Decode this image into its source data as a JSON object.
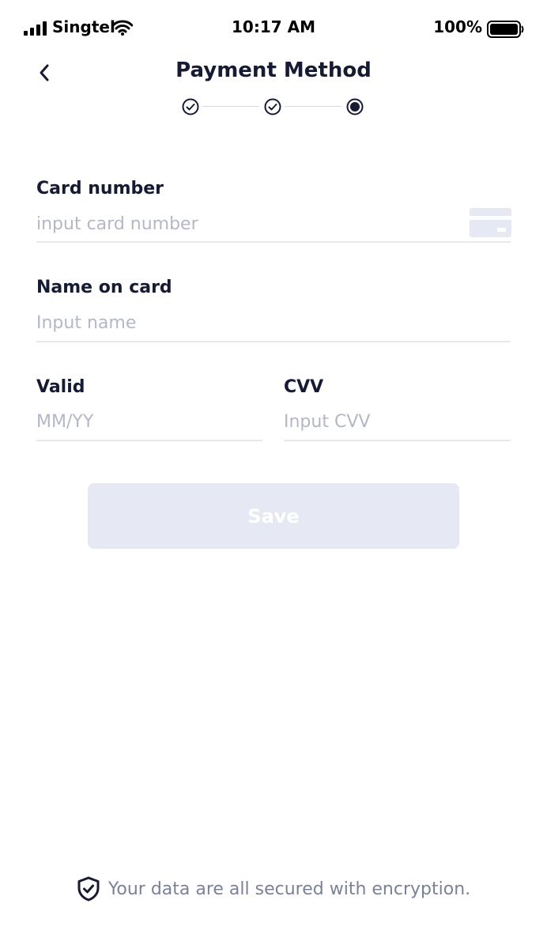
{
  "status_bar": {
    "carrier": "Singtel",
    "time": "10:17 AM",
    "battery": "100%"
  },
  "header": {
    "title": "Payment Method"
  },
  "stepper": {
    "steps": [
      "completed",
      "completed",
      "current"
    ]
  },
  "form": {
    "card_number": {
      "label": "Card number",
      "placeholder": "input card number",
      "value": ""
    },
    "name_on_card": {
      "label": "Name on card",
      "placeholder": "Input name",
      "value": ""
    },
    "valid": {
      "label": "Valid",
      "placeholder": "MM/YY",
      "value": ""
    },
    "cvv": {
      "label": "CVV",
      "placeholder": "Input CVV",
      "value": ""
    }
  },
  "save_button": {
    "label": "Save",
    "enabled": false
  },
  "footer": {
    "security_text": "Your data are all secured with encryption."
  },
  "colors": {
    "text_primary": "#161b33",
    "placeholder": "#b4b8c6",
    "disabled_button": "#e6e8f4",
    "divider": "#e8e9ee",
    "footer_text": "#7b8197"
  },
  "icons": [
    "signal-icon",
    "wifi-icon",
    "battery-icon",
    "back-chevron-icon",
    "check-circle-icon",
    "radio-current-icon",
    "credit-card-icon",
    "shield-check-icon"
  ]
}
